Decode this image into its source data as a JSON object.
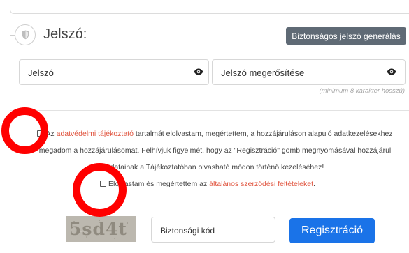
{
  "password_section": {
    "title": "Jelszó:",
    "generate_button": "Biztonságos jelszó generálás",
    "password_placeholder": "Jelszó",
    "confirm_placeholder": "Jelszó megerősítése",
    "hint": "(minimum 8 karakter hosszú)"
  },
  "consent": {
    "prefix": "Az",
    "link_text": "adatvédelmi tájékoztató",
    "rest_line1": "tartalmát elolvastam, megértettem, a hozzájáruláson alapuló adatkezelésekhez",
    "line2": "megadom a hozzájárulásomat. Felhívjuk figyelmét, hogy az \"Regisztráció\" gomb megnyomásával hozzájárul",
    "line3": "adatainak a Tájékoztatóban olvasható módon történő kezeléséhez!"
  },
  "terms": {
    "prefix": "Elolvastam és megértettem az",
    "link_text": "általános szerződési feltételeket",
    "suffix": "."
  },
  "captcha": {
    "text": "5sd4t",
    "code_placeholder": "Biztonsági kód",
    "submit_button": "Regisztráció"
  },
  "colors": {
    "link": "#e0533d",
    "primary_button": "#1a73e8",
    "generate_button": "#5f6a75",
    "annotation_ring": "#ff0000"
  },
  "icons": {
    "section": "shield-icon",
    "password_toggle": "eye-icon",
    "confirm_toggle": "eye-icon"
  }
}
